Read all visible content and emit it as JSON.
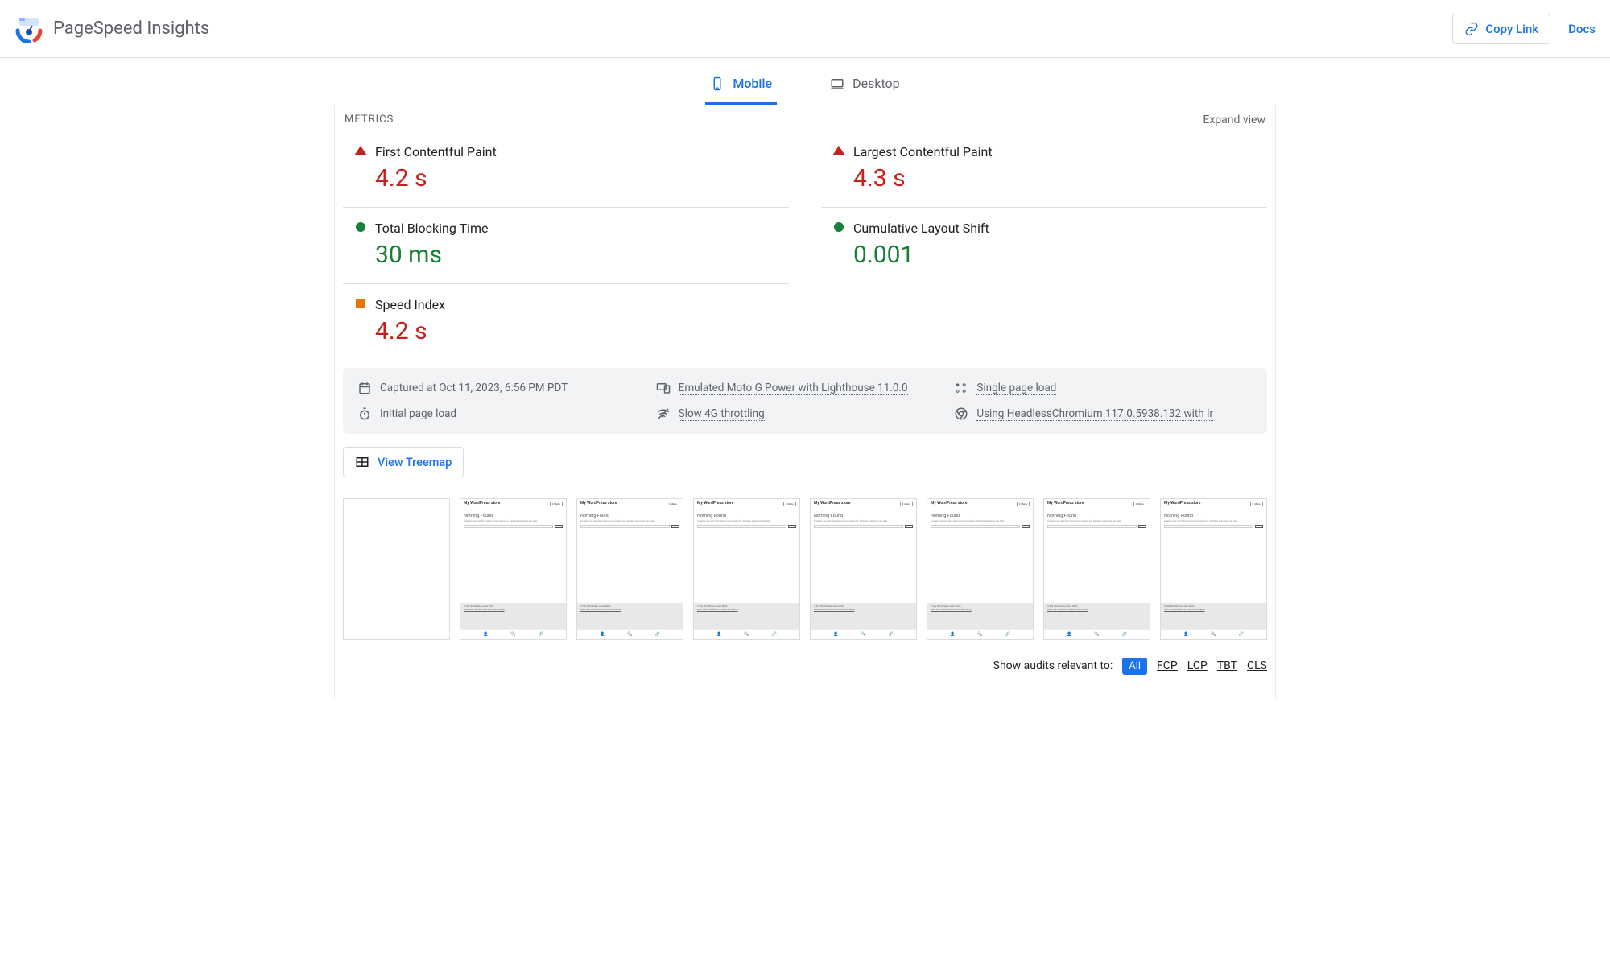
{
  "app_title": "PageSpeed Insights",
  "header": {
    "copy_link": "Copy Link",
    "docs": "Docs"
  },
  "tabs": {
    "mobile": "Mobile",
    "desktop": "Desktop"
  },
  "section": {
    "title": "METRICS",
    "expand": "Expand view"
  },
  "metrics": {
    "fcp": {
      "label": "First Contentful Paint",
      "value": "4.2 s"
    },
    "lcp": {
      "label": "Largest Contentful Paint",
      "value": "4.3 s"
    },
    "tbt": {
      "label": "Total Blocking Time",
      "value": "30 ms"
    },
    "cls": {
      "label": "Cumulative Layout Shift",
      "value": "0.001"
    },
    "si": {
      "label": "Speed Index",
      "value": "4.2 s"
    }
  },
  "info": {
    "captured": "Captured at Oct 11, 2023, 6:56 PM PDT",
    "device": "Emulated Moto G Power with Lighthouse 11.0.0",
    "single": "Single page load",
    "initial": "Initial page load",
    "throttle": "Slow 4G throttling",
    "browser": "Using HeadlessChromium 117.0.5938.132 with lr"
  },
  "treemap": "View Treemap",
  "frame": {
    "title": "My WordPress store",
    "menu": "Menu",
    "heading": "Nothing Found",
    "desc": "It seems we can't find what you're looking for. Perhaps searching can help.",
    "search_ph": "Search …",
    "search_btn": "Search",
    "copyright": "© My WordPress store 2023",
    "built": "Built with Storefront & WooCommerce"
  },
  "filter": {
    "label": "Show audits relevant to:",
    "all": "All",
    "fcp": "FCP",
    "lcp": "LCP",
    "tbt": "TBT",
    "cls": "CLS"
  }
}
